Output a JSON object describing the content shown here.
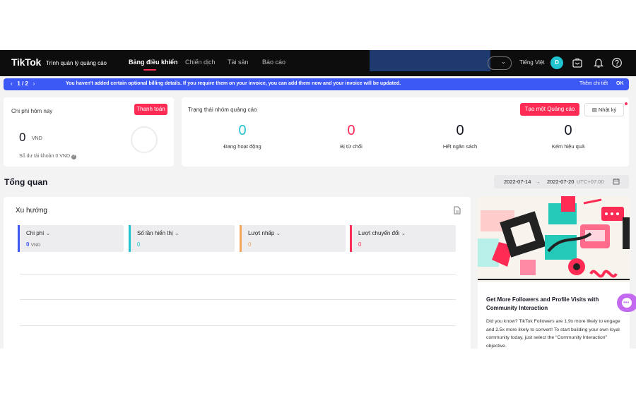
{
  "nav": {
    "logo": "TikTok",
    "logo_sub": "Trình quản lý quảng cáo",
    "links": [
      "Bảng điều khiển",
      "Chiến dịch",
      "Tài sản",
      "Báo cáo"
    ],
    "language": "Tiếng Việt",
    "avatar_initial": "D"
  },
  "banner": {
    "pager": "1 / 2",
    "message": "You haven't added certain optional billing details. If you require them on your invoice, you can add them now and your invoice will be updated.",
    "detail_link": "Thêm chi tiết",
    "ok": "OK"
  },
  "spend": {
    "title": "Chi phí hôm nay",
    "pay_button": "Thanh toán",
    "amount": "0",
    "currency": "VND",
    "balance": "Số dư tài khoản 0 VND"
  },
  "adgroup_status": {
    "title": "Trạng thái nhóm quảng cáo",
    "create_button": "Tạo một Quảng cáo",
    "log_button": "Nhật ký",
    "items": [
      {
        "value": "0",
        "label": "Đang hoạt động",
        "color": "#20c3d0"
      },
      {
        "value": "0",
        "label": "Bị từ chối",
        "color": "#fe2c55"
      },
      {
        "value": "0",
        "label": "Hết ngân sách",
        "color": "#161823"
      },
      {
        "value": "0",
        "label": "Kém hiệu quả",
        "color": "#161823"
      }
    ]
  },
  "overview": {
    "title": "Tổng quan",
    "date_start": "2022-07-14",
    "date_end": "2022-07-20",
    "timezone": "UTC+07:00"
  },
  "trend": {
    "title": "Xu hướng",
    "metrics": [
      {
        "label": "Chi phí",
        "value": "0",
        "unit": "VND",
        "color": "#3d59f5"
      },
      {
        "label": "Số lần hiển thị",
        "value": "0",
        "unit": "",
        "color": "#20c3d0"
      },
      {
        "label": "Lượt nhấp",
        "value": "0",
        "unit": "",
        "color": "#f5a55a"
      },
      {
        "label": "Lượt chuyển đổi",
        "value": "0",
        "unit": "",
        "color": "#fe2c55"
      }
    ]
  },
  "promo": {
    "title": "Get More Followers and Profile Visits with Community Interaction",
    "body": "Did you know? TikTok Followers are 1.9x more likely to engage and 2.5x more likely to convert! To start building your own loyal community today, just select the \"Community Interaction\" objective."
  }
}
